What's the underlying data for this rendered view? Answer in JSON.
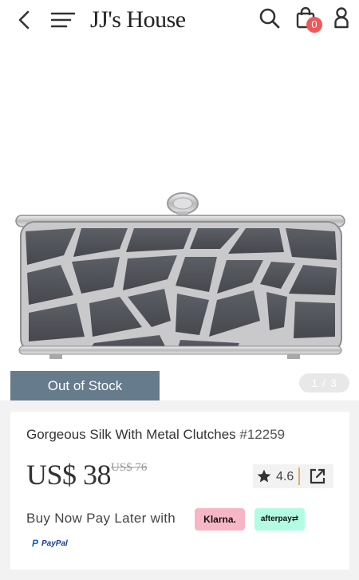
{
  "header": {
    "logo": "JJ's House",
    "cart_count": "0",
    "icons": [
      "back-arrow-icon",
      "menu-icon",
      "search-icon",
      "shopping-bag-icon",
      "user-icon"
    ]
  },
  "gallery": {
    "stock_label": "Out of Stock",
    "pager": "1 / 3"
  },
  "product": {
    "name": "Gorgeous Silk With Metal Clutches",
    "sku": "#12259",
    "price": "US$ 38",
    "original_price": "US$ 76",
    "rating": "4.6",
    "bnpl_label": "Buy Now Pay Later with",
    "klarna_label": "Klarna.",
    "afterpay_label": "afterpay",
    "paypal_label": "PayPal"
  },
  "colors": {
    "badge": "#f0585a",
    "stock_bg": "#667b8c",
    "klarna_bg": "#f7b6c6",
    "afterpay_bg": "#b2fce4",
    "rating_divider": "#d8b26a"
  }
}
